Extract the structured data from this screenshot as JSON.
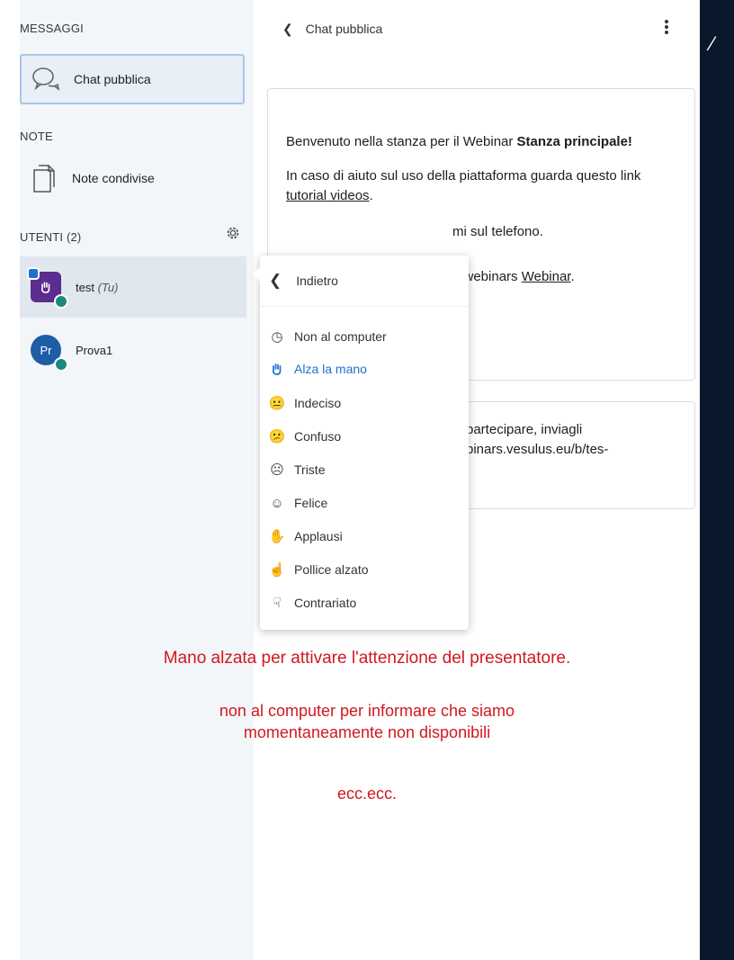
{
  "sidebar": {
    "messages_title": "MESSAGGI",
    "public_chat": "Chat pubblica",
    "notes_title": "NOTE",
    "shared_notes": "Note condivise",
    "users_title": "UTENTI (2)",
    "users": [
      {
        "name": "test",
        "suffix": "(Tu)",
        "initials": ""
      },
      {
        "name": "Prova1",
        "suffix": "",
        "initials": "Pr"
      }
    ]
  },
  "chat": {
    "header": "Chat pubblica",
    "welcome_p1_a": "Benvenuto nella stanza per il Webinar ",
    "welcome_p1_b": "Stanza principale",
    "welcome_p1_c": "!",
    "welcome_p2_a": "In caso di aiuto sul uso della piattaforma guarda questo link ",
    "welcome_p2_link": "tutorial videos",
    "welcome_p2_c": ".",
    "welcome_p3": "mi sul telefono.",
    "welcome_p4_a": "n webinars ",
    "welcome_p4_link": "Webinar",
    "welcome_p4_c": ".",
    "invite_line1": "partecipare, inviagli",
    "invite_line2": "binars.vesulus.eu/b/tes-"
  },
  "menu": {
    "back": "Indietro",
    "items": [
      {
        "label": "Non al computer",
        "icon": "clock-icon"
      },
      {
        "label": "Alza la mano",
        "icon": "hand-icon"
      },
      {
        "label": "Indeciso",
        "icon": "neutral-face-icon"
      },
      {
        "label": "Confuso",
        "icon": "confused-face-icon"
      },
      {
        "label": "Triste",
        "icon": "sad-face-icon"
      },
      {
        "label": "Felice",
        "icon": "happy-face-icon"
      },
      {
        "label": "Applausi",
        "icon": "applause-icon"
      },
      {
        "label": "Pollice alzato",
        "icon": "thumbs-up-icon"
      },
      {
        "label": "Contrariato",
        "icon": "thumbs-down-icon"
      }
    ]
  },
  "annotation": {
    "line1": "Mano alzata per attivare l'attenzione del presentatore.",
    "line2": "non al computer per informare che siamo",
    "line3": "momentaneamente non disponibili",
    "line4": "ecc.ecc."
  },
  "colors": {
    "accent": "#1f6fd1",
    "annotation_red": "#d0181e",
    "dark_panel": "#09182a"
  }
}
